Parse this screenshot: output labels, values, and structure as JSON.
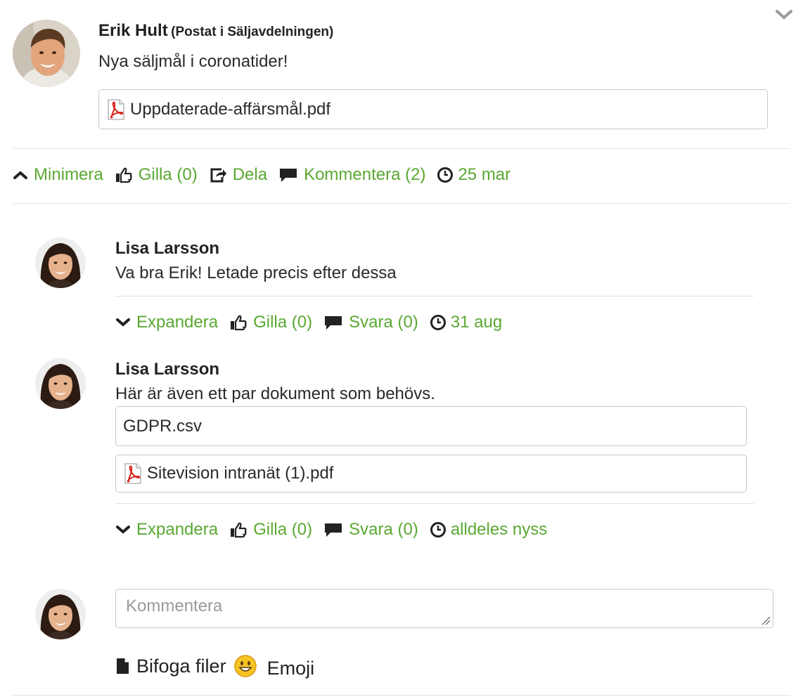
{
  "post": {
    "author": "Erik Hult",
    "posted_in": "(Postat i Säljavdelningen)",
    "text": "Nya säljmål i coronatider!",
    "attachment": "Uppdaterade-affärsmål.pdf",
    "actions": {
      "minimize": "Minimera",
      "like": "Gilla (0)",
      "share": "Dela",
      "comment": "Kommentera (2)",
      "date": "25 mar"
    }
  },
  "comments": [
    {
      "author": "Lisa Larsson",
      "text": "Va bra Erik! Letade precis efter dessa",
      "expand": "Expandera",
      "like": "Gilla (0)",
      "reply": "Svara (0)",
      "date": "31 aug"
    },
    {
      "author": "Lisa Larsson",
      "text": "Här är även ett par dokument som behövs.",
      "attachments": [
        "GDPR.csv",
        "Sitevision intranät (1).pdf"
      ],
      "expand": "Expandera",
      "like": "Gilla (0)",
      "reply": "Svara (0)",
      "date": "alldeles nyss"
    }
  ],
  "composer": {
    "placeholder": "Kommentera",
    "attach_label": "Bifoga filer",
    "emoji_label": "Emoji"
  },
  "colors": {
    "accent": "#5aa832",
    "border": "#c9c9c9"
  }
}
